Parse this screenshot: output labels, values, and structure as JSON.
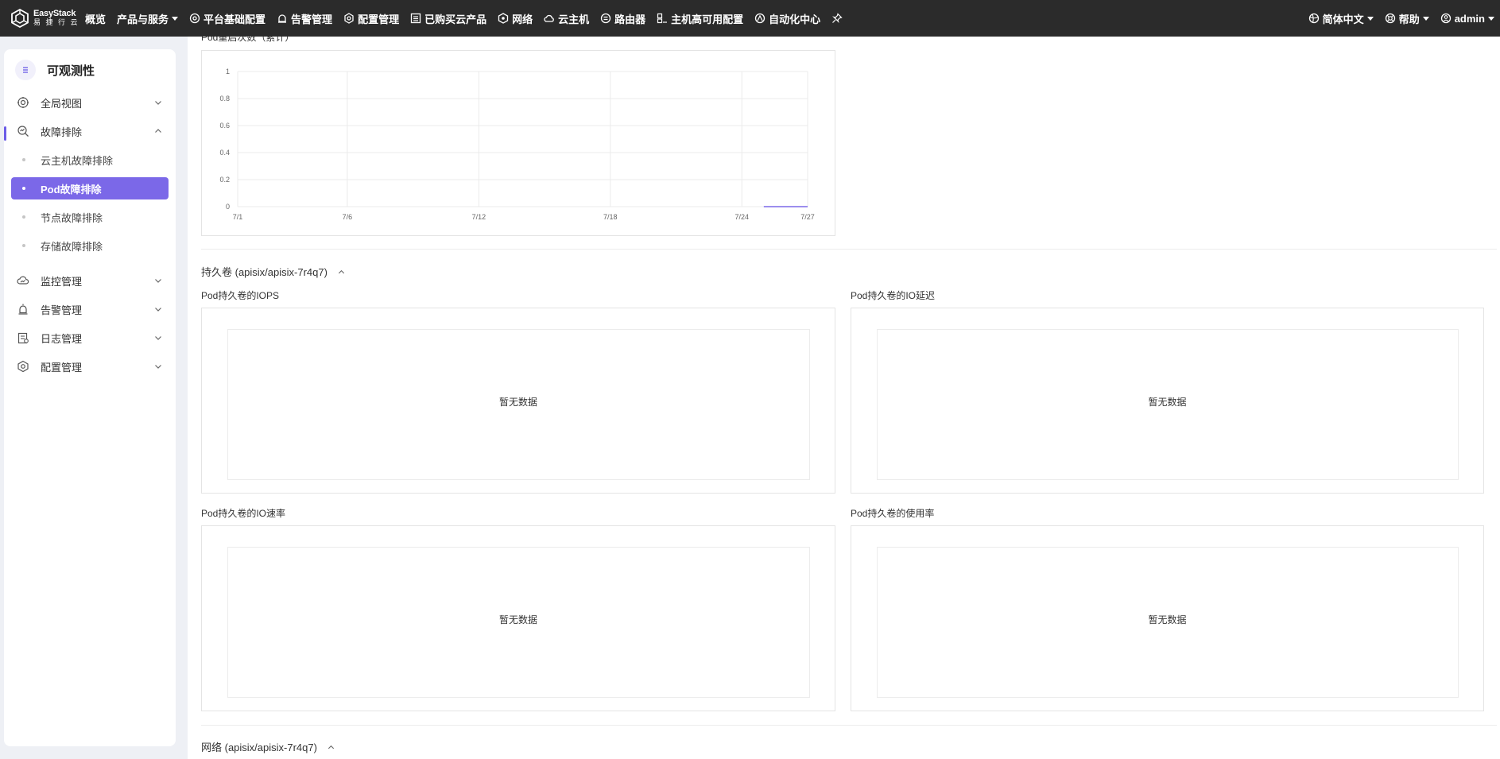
{
  "brand": {
    "name": "EasyStack",
    "sub": "易 捷 行 云"
  },
  "topnav": {
    "items": [
      {
        "label": "概览",
        "icon": ""
      },
      {
        "label": "产品与服务",
        "icon": "",
        "dropdown": true
      },
      {
        "label": "平台基础配置",
        "icon": "gear-icon"
      },
      {
        "label": "告警管理",
        "icon": "alarm-icon"
      },
      {
        "label": "配置管理",
        "icon": "gear-icon"
      },
      {
        "label": "已购买云产品",
        "icon": "list-icon"
      },
      {
        "label": "网络",
        "icon": "network-icon"
      },
      {
        "label": "云主机",
        "icon": "cloud-icon"
      },
      {
        "label": "路由器",
        "icon": "router-icon"
      },
      {
        "label": "主机高可用配置",
        "icon": "host-icon"
      },
      {
        "label": "自动化中心",
        "icon": "automation-icon"
      }
    ],
    "language": "简体中文",
    "help": "帮助",
    "user": "admin"
  },
  "sidebar": {
    "title": "可观测性",
    "items": [
      {
        "label": "全局视图",
        "icon": "globe-gear-icon",
        "expanded": false
      },
      {
        "label": "故障排除",
        "icon": "search-chart-icon",
        "expanded": true
      },
      {
        "label": "云主机故障排除"
      },
      {
        "label": "Pod故障排除",
        "active": true
      },
      {
        "label": "节点故障排除"
      },
      {
        "label": "存储故障排除"
      },
      {
        "label": "监控管理",
        "icon": "cloud-monitor-icon",
        "expanded": false
      },
      {
        "label": "告警管理",
        "icon": "alarm-icon",
        "expanded": false
      },
      {
        "label": "日志管理",
        "icon": "log-icon",
        "expanded": false
      },
      {
        "label": "配置管理",
        "icon": "gear-icon",
        "expanded": false
      }
    ]
  },
  "main": {
    "top_chart_title": "Pod重启次数（累计）",
    "volume_section": "持久卷 (apisix/apisix-7r4q7)",
    "panels": {
      "iops": "Pod持久卷的IOPS",
      "latency": "Pod持久卷的IO延迟",
      "rate": "Pod持久卷的IO速率",
      "usage": "Pod持久卷的使用率"
    },
    "no_data": "暂无数据",
    "network_section": "网络 (apisix/apisix-7r4q7)"
  },
  "chart_data": {
    "type": "line",
    "title": "Pod重启次数（累计）",
    "x": [
      "7/1",
      "7/6",
      "7/12",
      "7/18",
      "7/24",
      "7/27"
    ],
    "yticks": [
      "0",
      "0.2",
      "0.4",
      "0.6",
      "0.8",
      "1"
    ],
    "ylim": [
      0,
      1
    ],
    "series": [
      {
        "values": [
          0,
          0
        ]
      }
    ],
    "series_x_range": [
      "7/25",
      "7/27"
    ],
    "grid": true,
    "line_color": "#7b68e8"
  }
}
